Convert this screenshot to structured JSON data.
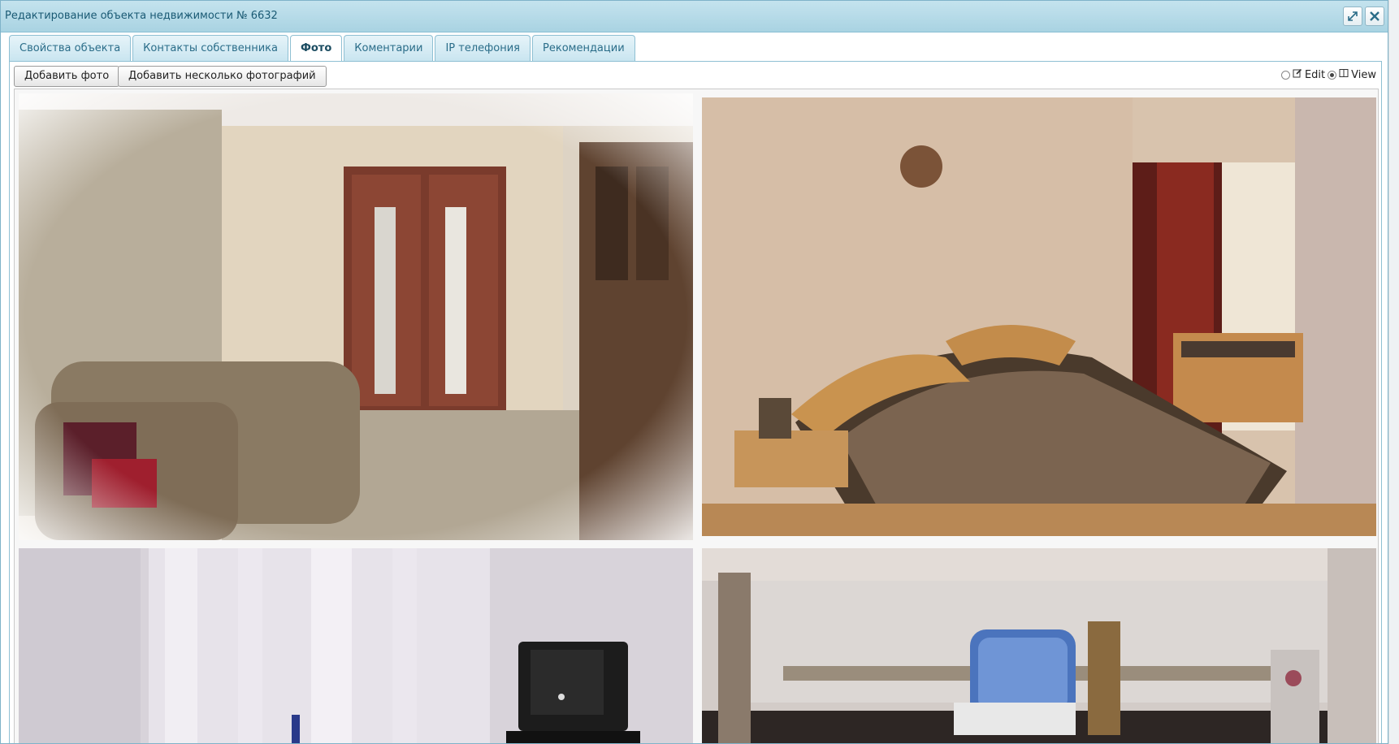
{
  "window": {
    "title": "Редактирование объекта недвижимости № 6632",
    "maximize_icon": "maximize-icon",
    "close_icon": "close-icon"
  },
  "tabs": [
    {
      "label": "Свойства объекта",
      "active": false
    },
    {
      "label": "Контакты собственника",
      "active": false
    },
    {
      "label": "Фото",
      "active": true
    },
    {
      "label": "Коментарии",
      "active": false
    },
    {
      "label": "IP телефония",
      "active": false
    },
    {
      "label": "Рекомендации",
      "active": false
    }
  ],
  "toolbar": {
    "add_photo_label": "Добавить фото",
    "add_multiple_label": "Добавить несколько фотографий",
    "edit_label": "Edit",
    "view_label": "View",
    "selected_mode": "View"
  },
  "photos": [
    {
      "name": "living-room-photo"
    },
    {
      "name": "bedroom-photo"
    },
    {
      "name": "room-tv-photo"
    },
    {
      "name": "kitchen-photo"
    }
  ],
  "colors": {
    "titlebar": "#b6dbe8",
    "tab_border": "#8fc0d3",
    "title_text": "#1a5a74"
  }
}
